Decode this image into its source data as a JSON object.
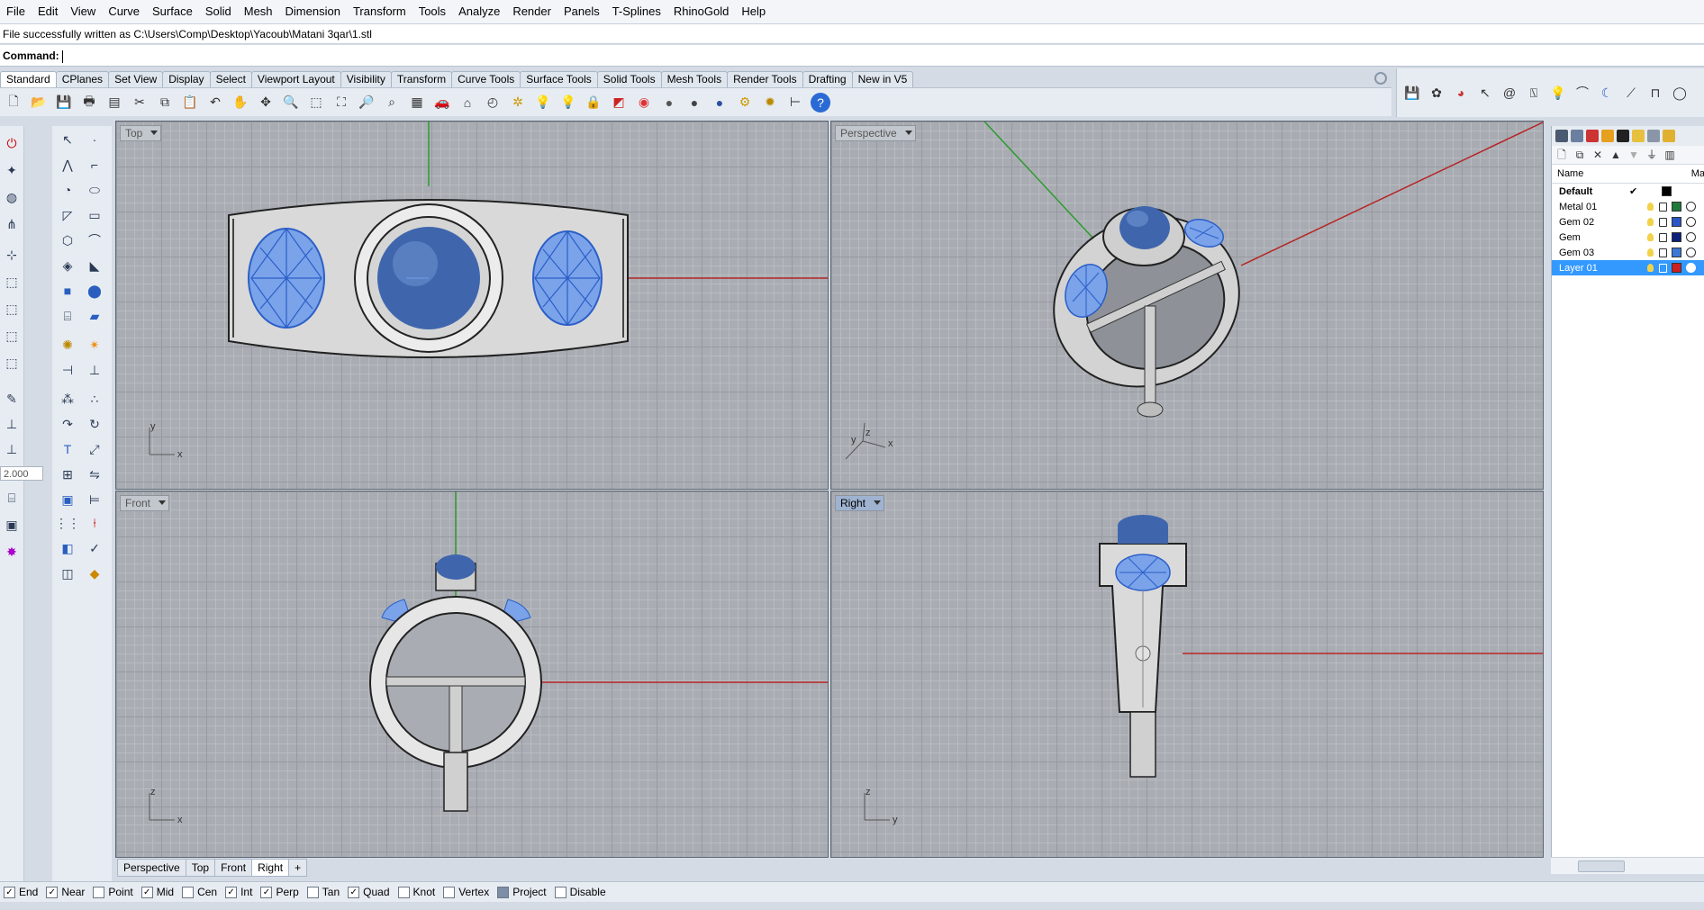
{
  "menu": [
    "File",
    "Edit",
    "View",
    "Curve",
    "Surface",
    "Solid",
    "Mesh",
    "Dimension",
    "Transform",
    "Tools",
    "Analyze",
    "Render",
    "Panels",
    "T-Splines",
    "RhinoGold",
    "Help"
  ],
  "command_history": "File successfully written as C:\\Users\\Comp\\Desktop\\Yacoub\\Matani 3qar\\1.stl",
  "command_prompt": "Command:",
  "tabs": [
    "Standard",
    "CPlanes",
    "Set View",
    "Display",
    "Select",
    "Viewport Layout",
    "Visibility",
    "Transform",
    "Curve Tools",
    "Surface Tools",
    "Solid Tools",
    "Mesh Tools",
    "Render Tools",
    "Drafting",
    "New in V5"
  ],
  "active_tab": "Standard",
  "thickness_value": "2.000",
  "viewports": {
    "top": {
      "label": "Top"
    },
    "perspective": {
      "label": "Perspective"
    },
    "front": {
      "label": "Front"
    },
    "right": {
      "label": "Right"
    }
  },
  "axis_labels": {
    "x": "x",
    "y": "y",
    "z": "z"
  },
  "viewport_tabs": [
    "Perspective",
    "Top",
    "Front",
    "Right"
  ],
  "active_viewport_tab": "Right",
  "layers": {
    "header": {
      "name": "Name",
      "material": "Ma"
    },
    "rows": [
      {
        "name": "Default",
        "current": true,
        "color": "#000000",
        "bold": true
      },
      {
        "name": "Metal 01",
        "color": "#1f7a3a"
      },
      {
        "name": "Gem 02",
        "color": "#2a56c6"
      },
      {
        "name": "Gem",
        "color": "#0a1f7a"
      },
      {
        "name": "Gem 03",
        "color": "#3a78d6"
      },
      {
        "name": "Layer 01",
        "color": "#cc1f1f",
        "selected": true
      }
    ]
  },
  "osnaps": [
    {
      "label": "End",
      "checked": true
    },
    {
      "label": "Near",
      "checked": true
    },
    {
      "label": "Point",
      "checked": false
    },
    {
      "label": "Mid",
      "checked": true
    },
    {
      "label": "Cen",
      "checked": false
    },
    {
      "label": "Int",
      "checked": true
    },
    {
      "label": "Perp",
      "checked": true
    },
    {
      "label": "Tan",
      "checked": false
    },
    {
      "label": "Quad",
      "checked": true
    },
    {
      "label": "Knot",
      "checked": false
    },
    {
      "label": "Vertex",
      "checked": false
    },
    {
      "label": "Project",
      "checked": true
    },
    {
      "label": "Disable",
      "checked": false
    }
  ],
  "colors": {
    "gem": "#3f66ad",
    "gem_wire": "#6f9be8",
    "metal": "#d8d8d8",
    "x_axis": "#b52424",
    "y_axis": "#2e9a2e"
  }
}
